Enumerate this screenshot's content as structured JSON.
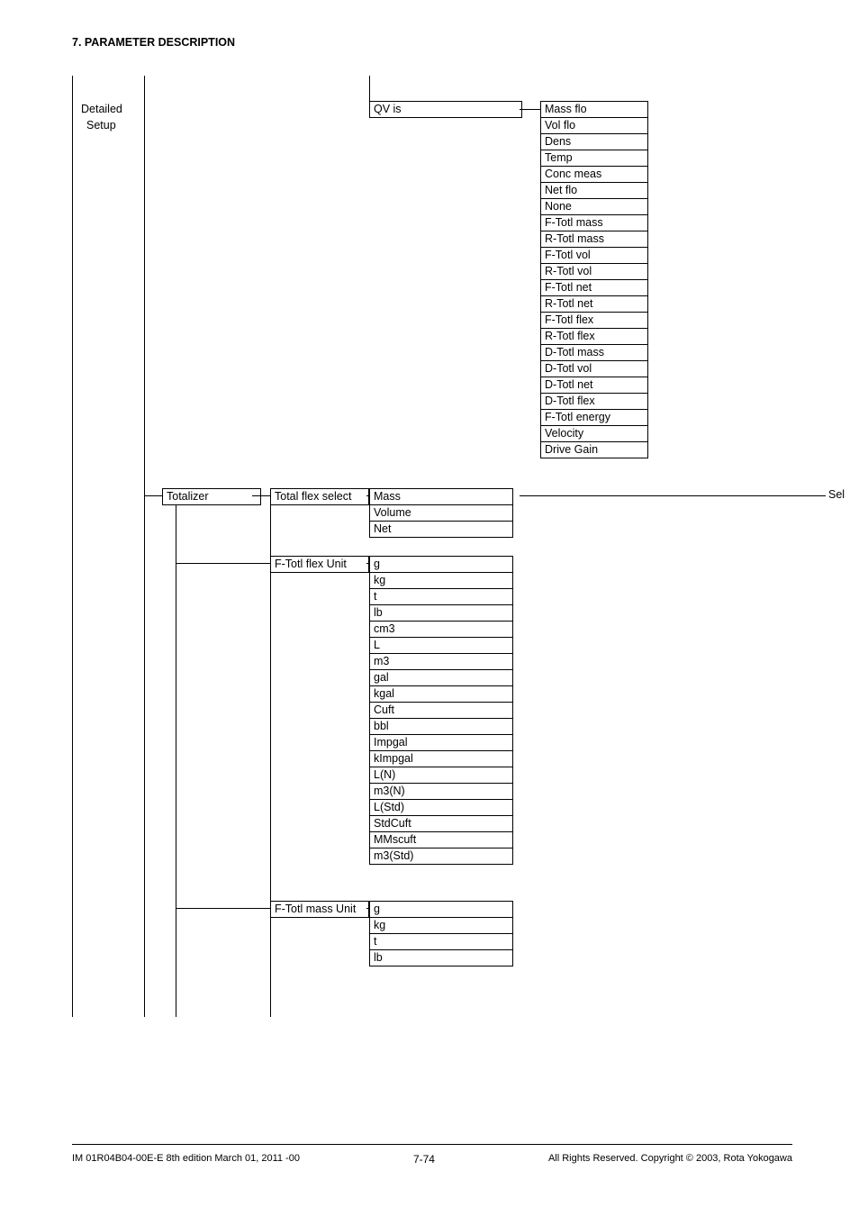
{
  "header": {
    "section_title": "7. PARAMETER DESCRIPTION"
  },
  "left": {
    "line1": "Detailed",
    "line2": "Setup"
  },
  "qv": {
    "label": "QV is",
    "items": [
      "Mass flo",
      "Vol flo",
      "Dens",
      "Temp",
      "Conc meas",
      "Net flo",
      "None",
      "F-Totl mass",
      "R-Totl mass",
      "F-Totl vol",
      "R-Totl vol",
      "F-Totl net",
      "R-Totl net",
      "F-Totl flex",
      "R-Totl flex",
      "D-Totl mass",
      "D-Totl vol",
      "D-Totl net",
      "D-Totl flex",
      "F-Totl energy",
      "Velocity",
      "Drive Gain"
    ]
  },
  "totalizer": {
    "label": "Totalizer",
    "groups": [
      {
        "title": "Total flex select",
        "items": [
          "Mass",
          "Volume",
          "Net"
        ]
      },
      {
        "title": "F-Totl flex Unit",
        "items": [
          "g",
          "kg",
          "t",
          "lb",
          "cm3",
          "L",
          "m3",
          "gal",
          "kgal",
          "Cuft",
          "bbl",
          "Impgal",
          "kImpgal",
          "L(N)",
          "m3(N)",
          "L(Std)",
          "StdCuft",
          "MMscuft",
          "m3(Std)"
        ]
      },
      {
        "title": "F-Totl mass Unit",
        "items": [
          "g",
          "kg",
          "t",
          "lb"
        ]
      }
    ]
  },
  "right_label": "Sel",
  "footer": {
    "left": "IM 01R04B04-00E-E    8th edition March 01, 2011 -00",
    "center": "7-74",
    "right": "All Rights Reserved. Copyright © 2003, Rota Yokogawa"
  }
}
